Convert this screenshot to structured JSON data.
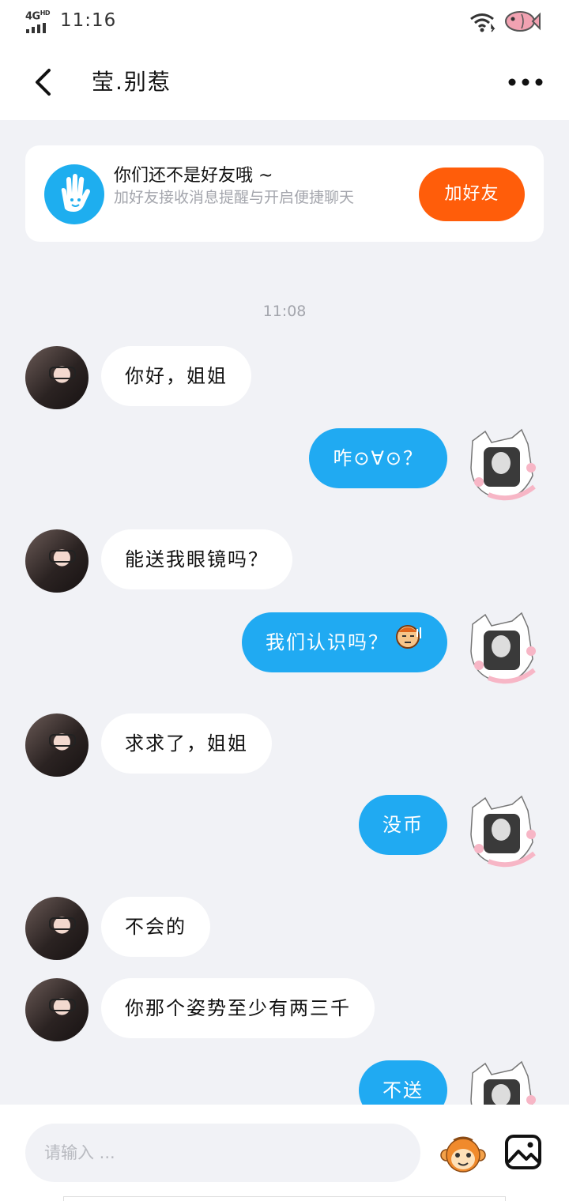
{
  "status_bar": {
    "network": "4G",
    "network_sup": "HD",
    "time": "11:16",
    "icons": [
      "signal-icon",
      "wifi-icon",
      "fish-icon"
    ]
  },
  "header": {
    "back_icon": "back-arrow-icon",
    "title": "莹.别惹",
    "more_icon": "more-dots-icon"
  },
  "friend_notice": {
    "icon": "wave-hand-icon",
    "title": "你们还不是好友哦 ~",
    "subtitle": "加好友接收消息提醒与开启便捷聊天",
    "button": "加好友",
    "button_color": "#ff5d0a"
  },
  "chat": {
    "timestamp": "11:08",
    "messages": [
      {
        "side": "in",
        "text": "你好，姐姐"
      },
      {
        "side": "out",
        "text": "咋⊙∀⊙？"
      },
      {
        "side": "in",
        "text": "能送我眼镜吗？"
      },
      {
        "side": "out",
        "text": "我们认识吗？",
        "emoji": "sweat-face-emoji"
      },
      {
        "side": "in",
        "text": "求求了，姐姐"
      },
      {
        "side": "out",
        "text": "没币"
      },
      {
        "side": "in",
        "text": "不会的"
      },
      {
        "side": "in",
        "text": "你那个姿势至少有两三千"
      },
      {
        "side": "out",
        "text": "不送"
      }
    ],
    "outgoing_bubble_color": "#20aaf2",
    "incoming_bubble_color": "#ffffff"
  },
  "input_bar": {
    "placeholder": "请输入 ...",
    "emoji_icon": "monkey-emoji-icon",
    "image_icon": "image-icon"
  }
}
